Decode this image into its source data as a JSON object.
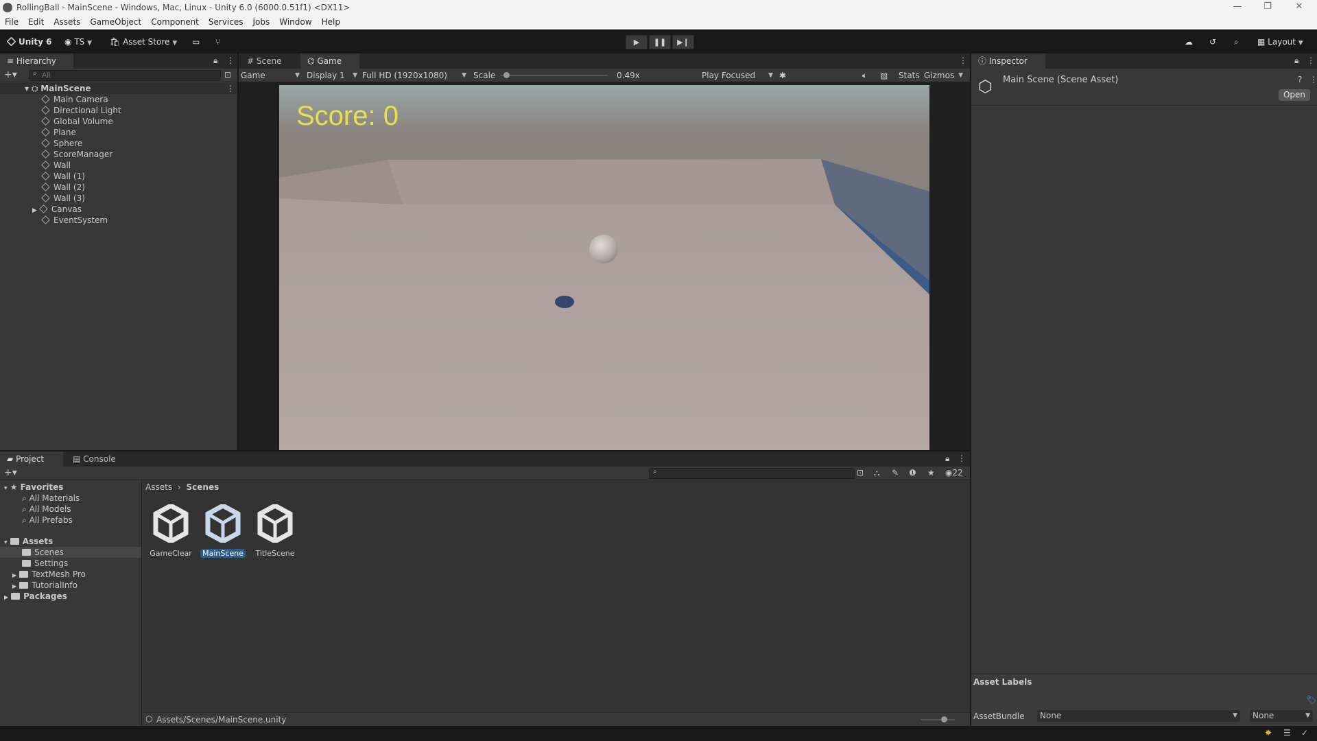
{
  "window": {
    "title": "RollingBall - MainScene - Windows, Mac, Linux - Unity 6.0 (6000.0.51f1) <DX11>"
  },
  "menu": [
    "File",
    "Edit",
    "Assets",
    "GameObject",
    "Component",
    "Services",
    "Jobs",
    "Window",
    "Help"
  ],
  "toolbar": {
    "unity_label": "Unity 6",
    "account_label": "TS",
    "asset_store_label": "Asset Store",
    "layout_label": "Layout"
  },
  "hierarchy": {
    "tab_label": "Hierarchy",
    "search_placeholder": "All",
    "scene_name": "MainScene",
    "items": [
      "Main Camera",
      "Directional Light",
      "Global Volume",
      "Plane",
      "Sphere",
      "ScoreManager",
      "Wall",
      "Wall (1)",
      "Wall (2)",
      "Wall (3)",
      "Canvas",
      "EventSystem"
    ]
  },
  "game_view": {
    "tabs": [
      "Scene",
      "Game"
    ],
    "mode": "Game",
    "display": "Display 1",
    "resolution": "Full HD (1920x1080)",
    "scale_label": "Scale",
    "scale_value": "0.49x",
    "scale_fraction": 0.05,
    "play_mode": "Play Focused",
    "stats_label": "Stats",
    "gizmos_label": "Gizmos",
    "score_text": "Score: 0",
    "score_color": "#e8e04a"
  },
  "inspector": {
    "tab_label": "Inspector",
    "asset_title": "Main Scene (Scene Asset)",
    "open_button": "Open",
    "asset_labels_heading": "Asset Labels",
    "assetbundle_label": "AssetBundle",
    "assetbundle_value": "None",
    "assetbundle_variant": "None"
  },
  "project": {
    "tabs": [
      "Project",
      "Console"
    ],
    "favorites_label": "Favorites",
    "favorites": [
      "All Materials",
      "All Models",
      "All Prefabs"
    ],
    "assets_label": "Assets",
    "asset_folders": [
      "Scenes",
      "Settings",
      "TextMesh Pro",
      "TutorialInfo"
    ],
    "packages_label": "Packages",
    "breadcrumb": [
      "Assets",
      "Scenes"
    ],
    "files": [
      "GameClear",
      "MainScene",
      "TitleScene"
    ],
    "selected_file": "MainScene",
    "hidden_count": "22",
    "path": "Assets/Scenes/MainScene.unity"
  },
  "colors": {
    "selection": "#2c5d87",
    "panel": "#383838",
    "toolbar": "#191919"
  }
}
